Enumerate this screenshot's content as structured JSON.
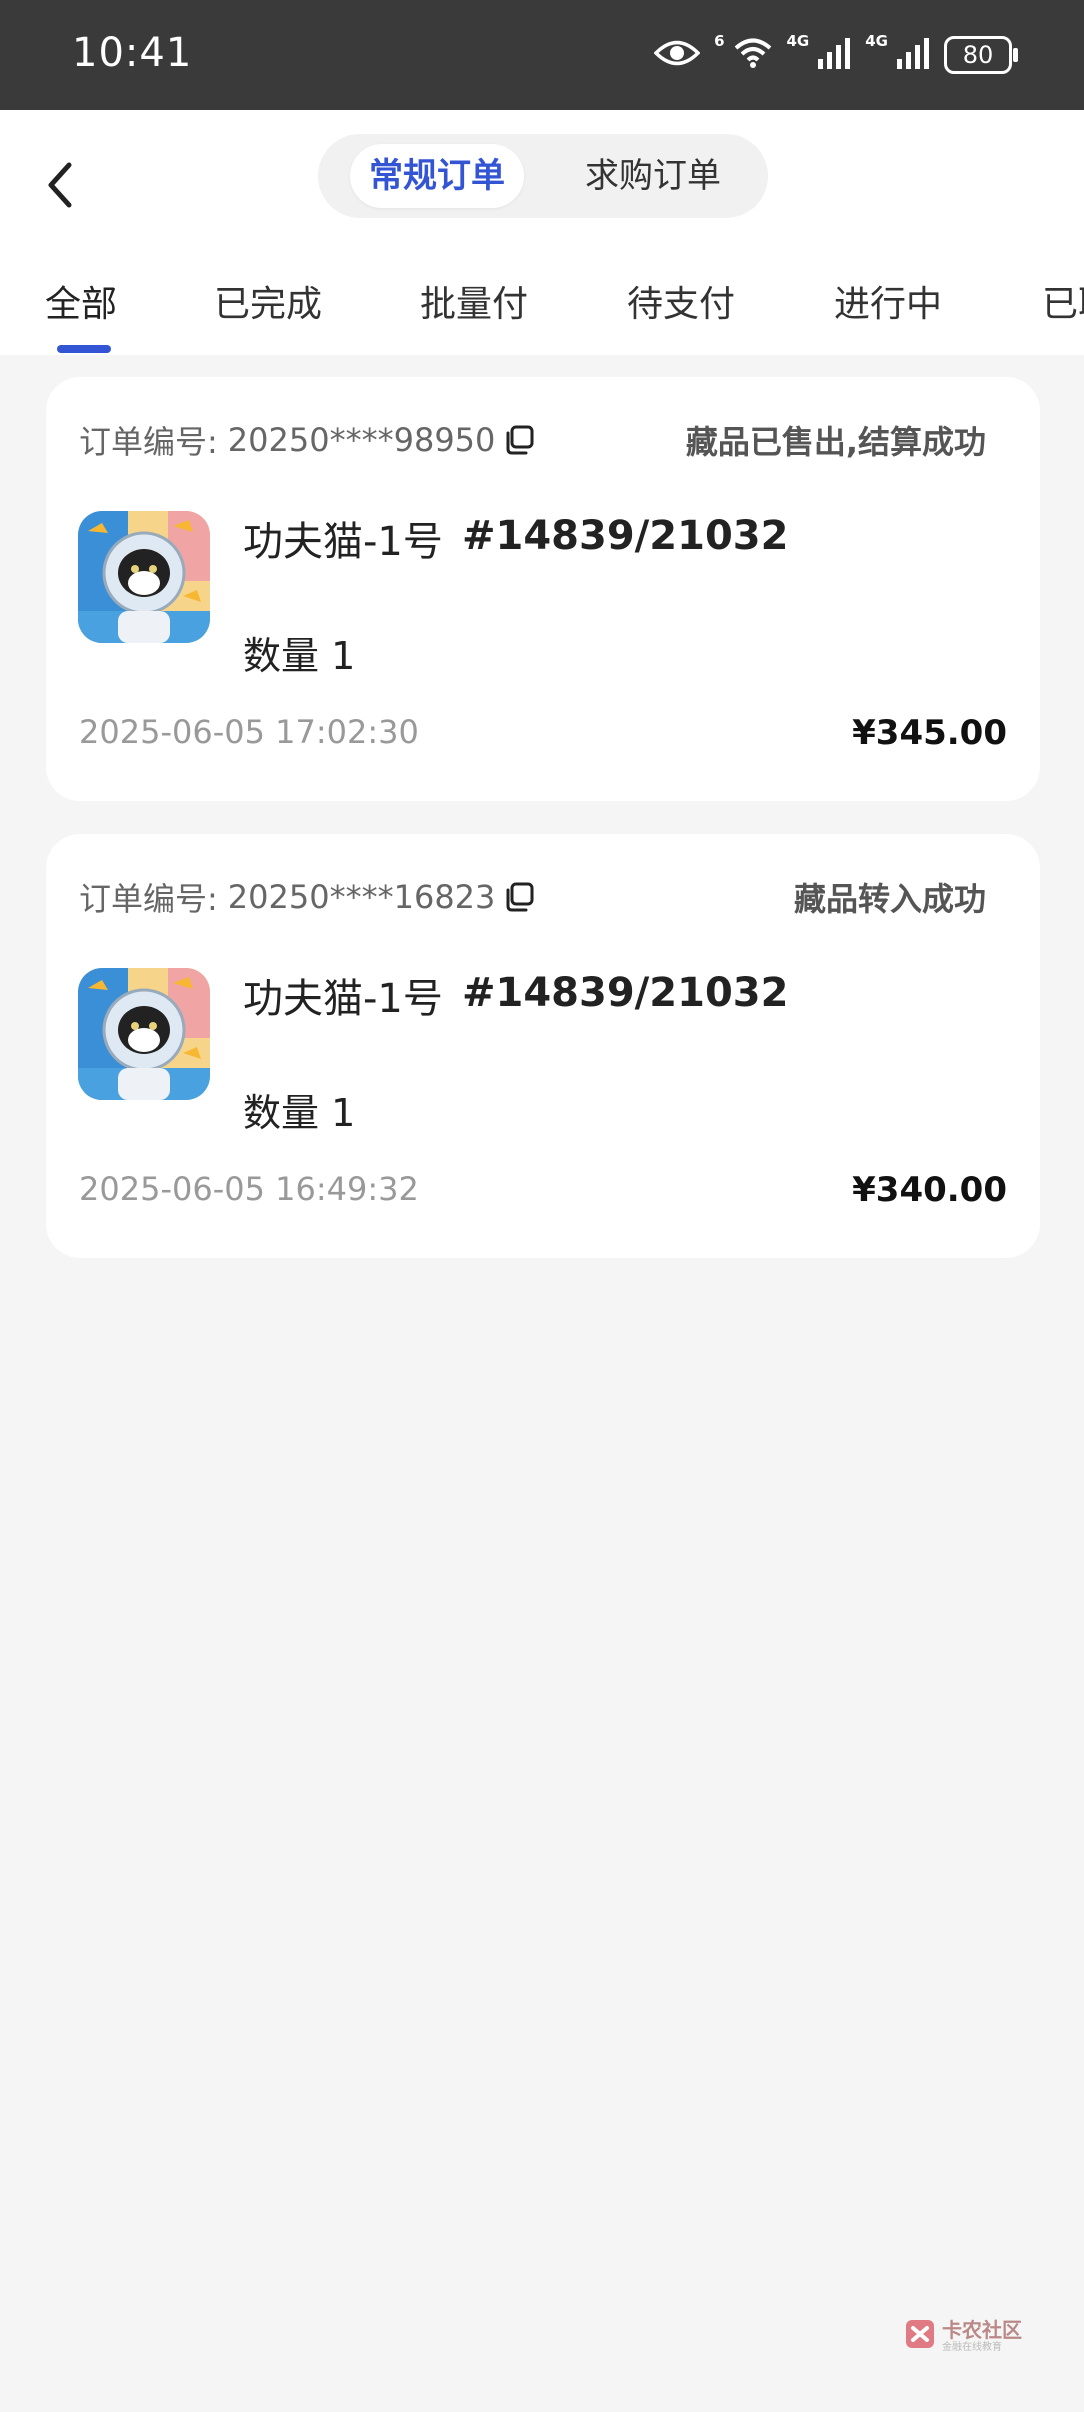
{
  "status_bar": {
    "time": "10:41",
    "wifi_label": "6",
    "signal1_label": "4G",
    "signal2_label": "4G",
    "battery": "80"
  },
  "header": {
    "segments": [
      "常规订单",
      "求购订单"
    ],
    "active_segment": 0,
    "tabs": [
      "全部",
      "已完成",
      "批量付",
      "待支付",
      "进行中",
      "已取消"
    ],
    "active_tab": 0,
    "accent_color": "#3355d4"
  },
  "orders": [
    {
      "order_label": "订单编号:",
      "order_no": "20250****98950",
      "status": "藏品已售出,结算成功",
      "product_name": "功夫猫-1号",
      "serial": "#14839/21032",
      "quantity": "数量 1",
      "datetime": "2025-06-05 17:02:30",
      "price": "¥345.00"
    },
    {
      "order_label": "订单编号:",
      "order_no": "20250****16823",
      "status": "藏品转入成功",
      "product_name": "功夫猫-1号",
      "serial": "#14839/21032",
      "quantity": "数量 1",
      "datetime": "2025-06-05 16:49:32",
      "price": "¥340.00"
    }
  ],
  "watermark": {
    "title": "卡农社区",
    "subtitle": "金融在线教育"
  }
}
